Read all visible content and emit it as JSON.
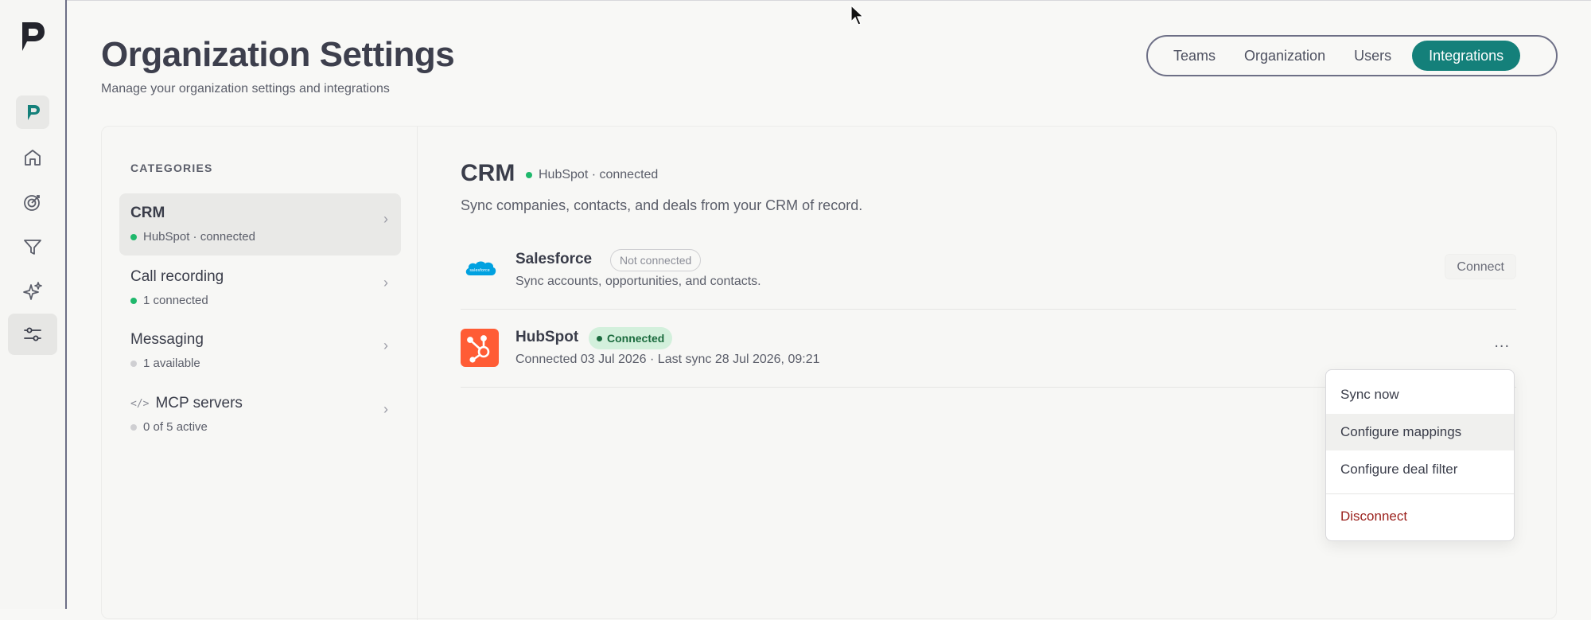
{
  "header": {
    "title": "Organization Settings",
    "subtitle": "Manage your organization settings and integrations"
  },
  "tabs": [
    {
      "label": "Teams",
      "active": false
    },
    {
      "label": "Organization",
      "active": false
    },
    {
      "label": "Users",
      "active": false
    },
    {
      "label": "Integrations",
      "active": true
    }
  ],
  "rail": {
    "icons": [
      "app-logo-icon",
      "brand-icon",
      "home-icon",
      "target-icon",
      "filter-icon",
      "sparkles-icon",
      "sliders-icon"
    ]
  },
  "categories": {
    "heading": "CATEGORIES",
    "items": [
      {
        "name": "CRM",
        "status": "HubSpot · connected",
        "status_color": "#1fb86c",
        "selected": true
      },
      {
        "name": "Call recording",
        "status": "1 connected",
        "status_color": "#1fb86c",
        "selected": false
      },
      {
        "name": "Messaging",
        "status": "1 available",
        "status_color": "#cfcfd2",
        "selected": false
      },
      {
        "name": "MCP servers",
        "icon": "code-icon",
        "status": "0 of 5 active",
        "status_color": "#cfcfd2",
        "selected": false
      }
    ]
  },
  "crm": {
    "title": "CRM",
    "status": "HubSpot · connected",
    "description": "Sync companies, contacts, and deals from your CRM of record."
  },
  "integrations": [
    {
      "name": "Salesforce",
      "badge": "Not connected",
      "description": "Sync accounts, opportunities, and contacts.",
      "action": "Connect",
      "logo": "salesforce-logo",
      "logo_text": "salesforce"
    },
    {
      "name": "HubSpot",
      "badge": "Connected",
      "description": "Connected 03 Jul 2026 · Last sync 28 Jul 2026, 09:21",
      "action": "...",
      "logo": "hubspot-logo"
    }
  ],
  "menu": {
    "items": [
      "Sync now",
      "Configure mappings",
      "Configure deal filter",
      "Disconnect"
    ]
  },
  "colors": {
    "accent": "#14807a",
    "connected_green": "#1fb86c",
    "danger": "#9a1f1b",
    "hubspot_orange": "#ff5c35",
    "salesforce_blue": "#00a1e0"
  }
}
